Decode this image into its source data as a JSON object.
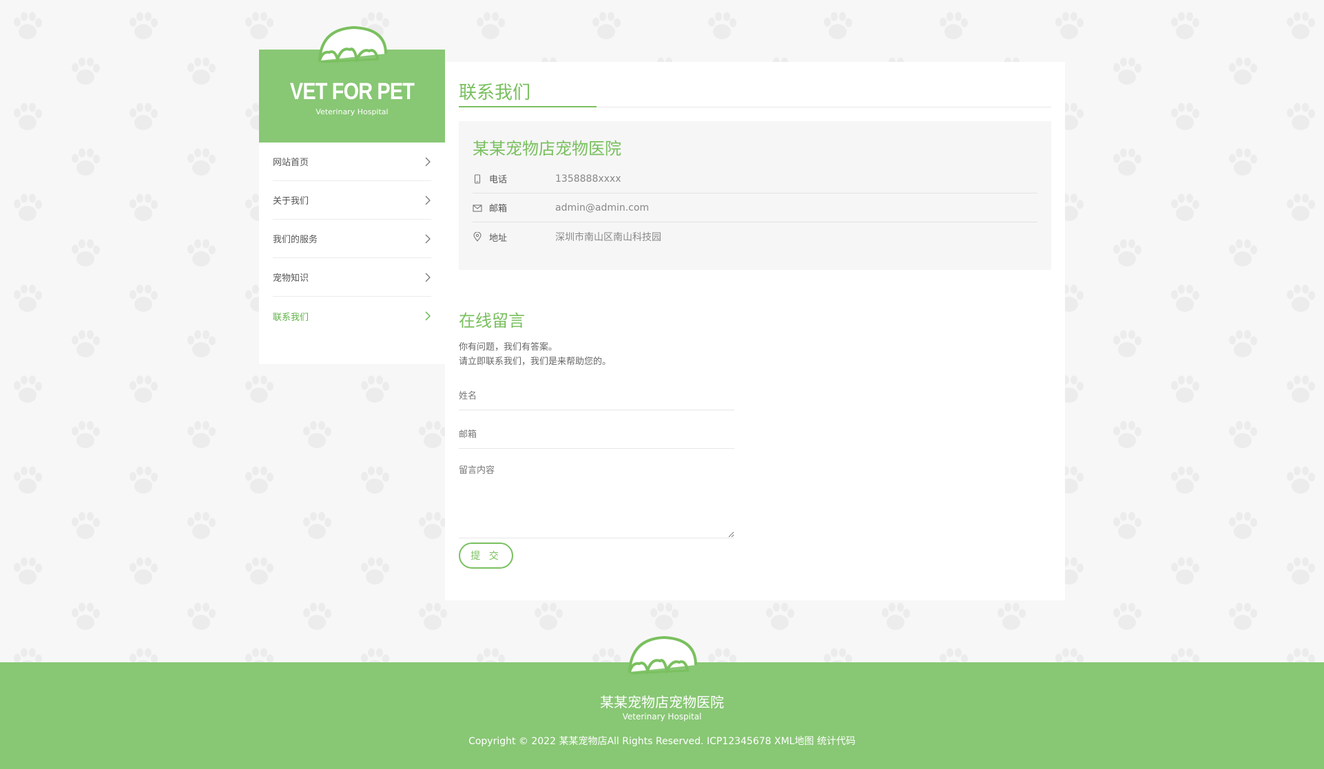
{
  "brand": {
    "title": "VET FOR PET",
    "subtitle": "Veterinary Hospital",
    "icon": "paw-icon",
    "color": "#88c774"
  },
  "sidebar": {
    "items": [
      {
        "label": "网站首页",
        "active": false
      },
      {
        "label": "关于我们",
        "active": false
      },
      {
        "label": "我们的服务",
        "active": false
      },
      {
        "label": "宠物知识",
        "active": false
      },
      {
        "label": "联系我们",
        "active": true
      }
    ]
  },
  "contact": {
    "title": "联系我们",
    "hospital_name": "某某宠物店宠物医院",
    "phone": {
      "label": "电话",
      "value": "1358888xxxx",
      "icon": "phone-icon"
    },
    "email": {
      "label": "邮箱",
      "value": "admin@admin.com",
      "icon": "mail-icon"
    },
    "address": {
      "label": "地址",
      "value": "深圳市南山区南山科技园",
      "icon": "location-pin-icon"
    }
  },
  "message": {
    "title": "在线留言",
    "desc_line1": "你有问题，我们有答案。",
    "desc_line2": "请立即联系我们，我们是来帮助您的。",
    "name_placeholder": "姓名",
    "email_placeholder": "邮箱",
    "content_placeholder": "留言内容",
    "submit_label": "提 交"
  },
  "footer": {
    "name": "某某宠物店宠物医院",
    "subtitle": "Veterinary Hospital",
    "copyright_prefix": "Copyright © 2022",
    "company_link": "某某宠物店",
    "rights": "All Rights Reserved.",
    "icp": "ICP12345678",
    "xml_map": "XML地图",
    "stats": "统计代码"
  },
  "colors": {
    "accent": "#7ac05f",
    "green_bg": "#88c774",
    "page_bg": "#f7f7f7"
  }
}
